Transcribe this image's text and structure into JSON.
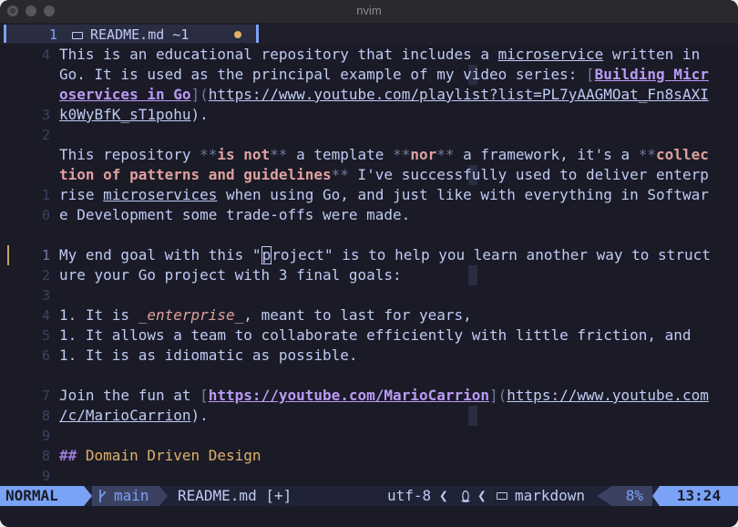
{
  "window": {
    "title": "nvim"
  },
  "buffer_tab": {
    "number": "1",
    "file_icon": "markdown-icon",
    "filename": "README.md ~1",
    "modified_indicator": "●"
  },
  "lines": {
    "ln": [
      "4",
      "",
      "",
      "3",
      "2",
      "",
      "",
      "1",
      "0",
      "",
      "1",
      "2",
      "3",
      "4",
      "5",
      "6",
      "",
      "7",
      "8",
      "9"
    ],
    "l1": {
      "a": "This is an educational repository that includes a ",
      "b": "microservice",
      "c": " written in"
    },
    "l2": {
      "a": "Go. It is used as the principal example of my video series: ",
      "b": "[",
      "c": "Building Micr"
    },
    "l3": {
      "a": "oservices in Go",
      "b": "](",
      "c": "https://www.youtube.com/playlist?list=PL7yAAGMOat_Fn8sAXI"
    },
    "l4": {
      "a": "k0WyBfK_sT1pohu",
      "b": ")."
    },
    "l6": {
      "a": "This repository ",
      "b": "**",
      "c": "is not",
      "d": "**",
      "e": " a template ",
      "f": "**",
      "g": "nor",
      "h": "**",
      "i": " a framework, it's a ",
      "j": "**",
      "k": "collec"
    },
    "l7": {
      "a": "tion of patterns and guidelines",
      "b": "**",
      "c": " I've successfully used to deliver enterp"
    },
    "l8": {
      "a": "rise ",
      "b": "microservices",
      "c": " when using Go, and just like with everything in Softwar"
    },
    "l9": {
      "a": "e Development some trade-offs were made."
    },
    "l11": {
      "a": "My end goal with this \"",
      "b": "p",
      "c": "roject\" is to help you learn another way to struct"
    },
    "l12": {
      "a": "ure your Go project with 3 final goals:"
    },
    "l14": {
      "a": "1. It is ",
      "b": "_enterprise_",
      "c": ", meant to last for years,"
    },
    "l15": {
      "a": "1. It allows a team to collaborate efficiently with little friction, and"
    },
    "l16": {
      "a": "1. It is as idiomatic as possible."
    },
    "l18": {
      "a": "Join the fun at ",
      "b": "[",
      "c": "https://youtube.com/MarioCarrion",
      "d": "](",
      "e": "https://www.youtube.com"
    },
    "l19": {
      "a": "/c/MarioCarrion",
      "b": ")."
    },
    "l21": {
      "a": "## ",
      "b": "Domain Driven Design"
    }
  },
  "statusline": {
    "mode": "NORMAL",
    "branch_icon": "git-branch-icon",
    "branch": "main",
    "file": "README.md [+]",
    "encoding": "utf-8",
    "os_icon": "linux-tux-icon",
    "filetype_icon": "markdown-icon",
    "filetype": "markdown",
    "progress": "8%",
    "position": "13:24"
  }
}
